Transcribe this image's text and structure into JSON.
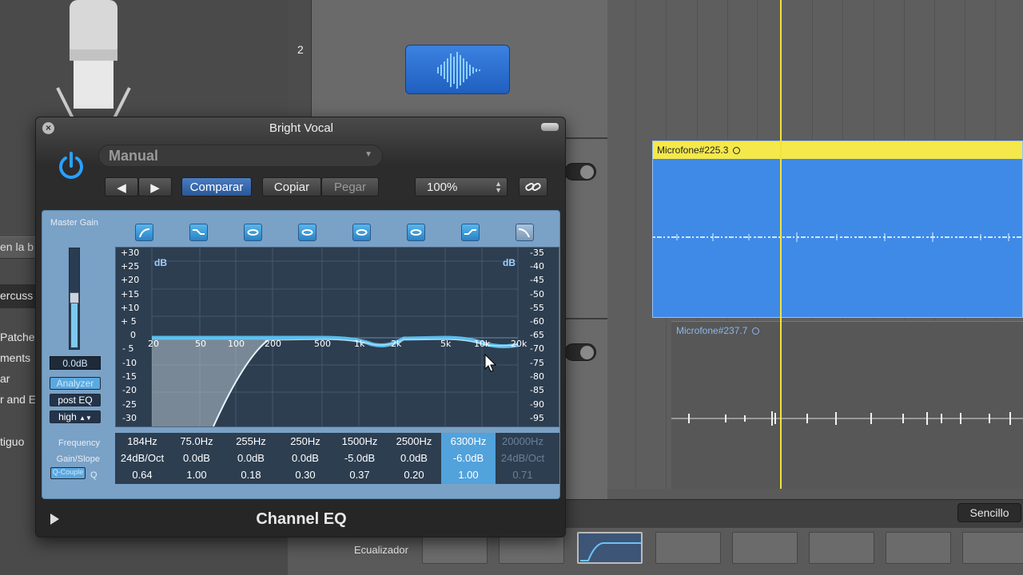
{
  "plugin": {
    "title": "Bright Vocal",
    "preset": "Manual",
    "compare": "Comparar",
    "copy": "Copiar",
    "paste": "Pegar",
    "zoom": "100%",
    "name": "Channel EQ",
    "master_gain_label": "Master Gain",
    "master_gain_value": "0.0dB",
    "analyzer": "Analyzer",
    "post_eq": "post EQ",
    "resolution": "high",
    "q_couple": "Q-Couple",
    "db_unit": "dB"
  },
  "graph": {
    "left_scale": [
      "+30",
      "+25",
      "+20",
      "+15",
      "+10",
      "+ 5",
      "0",
      "- 5",
      "-10",
      "-15",
      "-20",
      "-25",
      "-30"
    ],
    "right_scale": [
      "-35",
      "-40",
      "-45",
      "-50",
      "-55",
      "-60",
      "-65",
      "-70",
      "-75",
      "-80",
      "-85",
      "-90",
      "-95"
    ],
    "freq_ticks": [
      "20",
      "50",
      "100",
      "200",
      "500",
      "1k",
      "2k",
      "5k",
      "10k",
      "20k"
    ]
  },
  "params": {
    "row_labels": [
      "Frequency",
      "Gain/Slope",
      "Q"
    ],
    "bands": [
      {
        "freq": "184Hz",
        "gain": "24dB/Oct",
        "q": "0.64",
        "state": "on"
      },
      {
        "freq": "75.0Hz",
        "gain": "0.0dB",
        "q": "1.00",
        "state": "on"
      },
      {
        "freq": "255Hz",
        "gain": "0.0dB",
        "q": "0.18",
        "state": "on"
      },
      {
        "freq": "250Hz",
        "gain": "0.0dB",
        "q": "0.30",
        "state": "on"
      },
      {
        "freq": "1500Hz",
        "gain": "-5.0dB",
        "q": "0.37",
        "state": "on"
      },
      {
        "freq": "2500Hz",
        "gain": "0.0dB",
        "q": "0.20",
        "state": "on"
      },
      {
        "freq": "6300Hz",
        "gain": "-6.0dB",
        "q": "1.00",
        "state": "selected"
      },
      {
        "freq": "20000Hz",
        "gain": "24dB/Oct",
        "q": "0.71",
        "state": "off"
      }
    ]
  },
  "arrange": {
    "track_number": "2",
    "region1": "Microfone#225.3",
    "region2": "Microfone#237.7",
    "sencillo": "Sencillo",
    "mixer_eq_label": "Ecualizador"
  },
  "sidebar": {
    "lines": [
      "en la b",
      "ercuss",
      "Patche",
      "ments",
      "ar",
      "r and E",
      "tiguo"
    ]
  },
  "colors": {
    "accent": "#4a7cc0",
    "eq_curve": "#5ec8f8",
    "region_header": "#f5e84a",
    "playhead": "#f2e33a"
  }
}
